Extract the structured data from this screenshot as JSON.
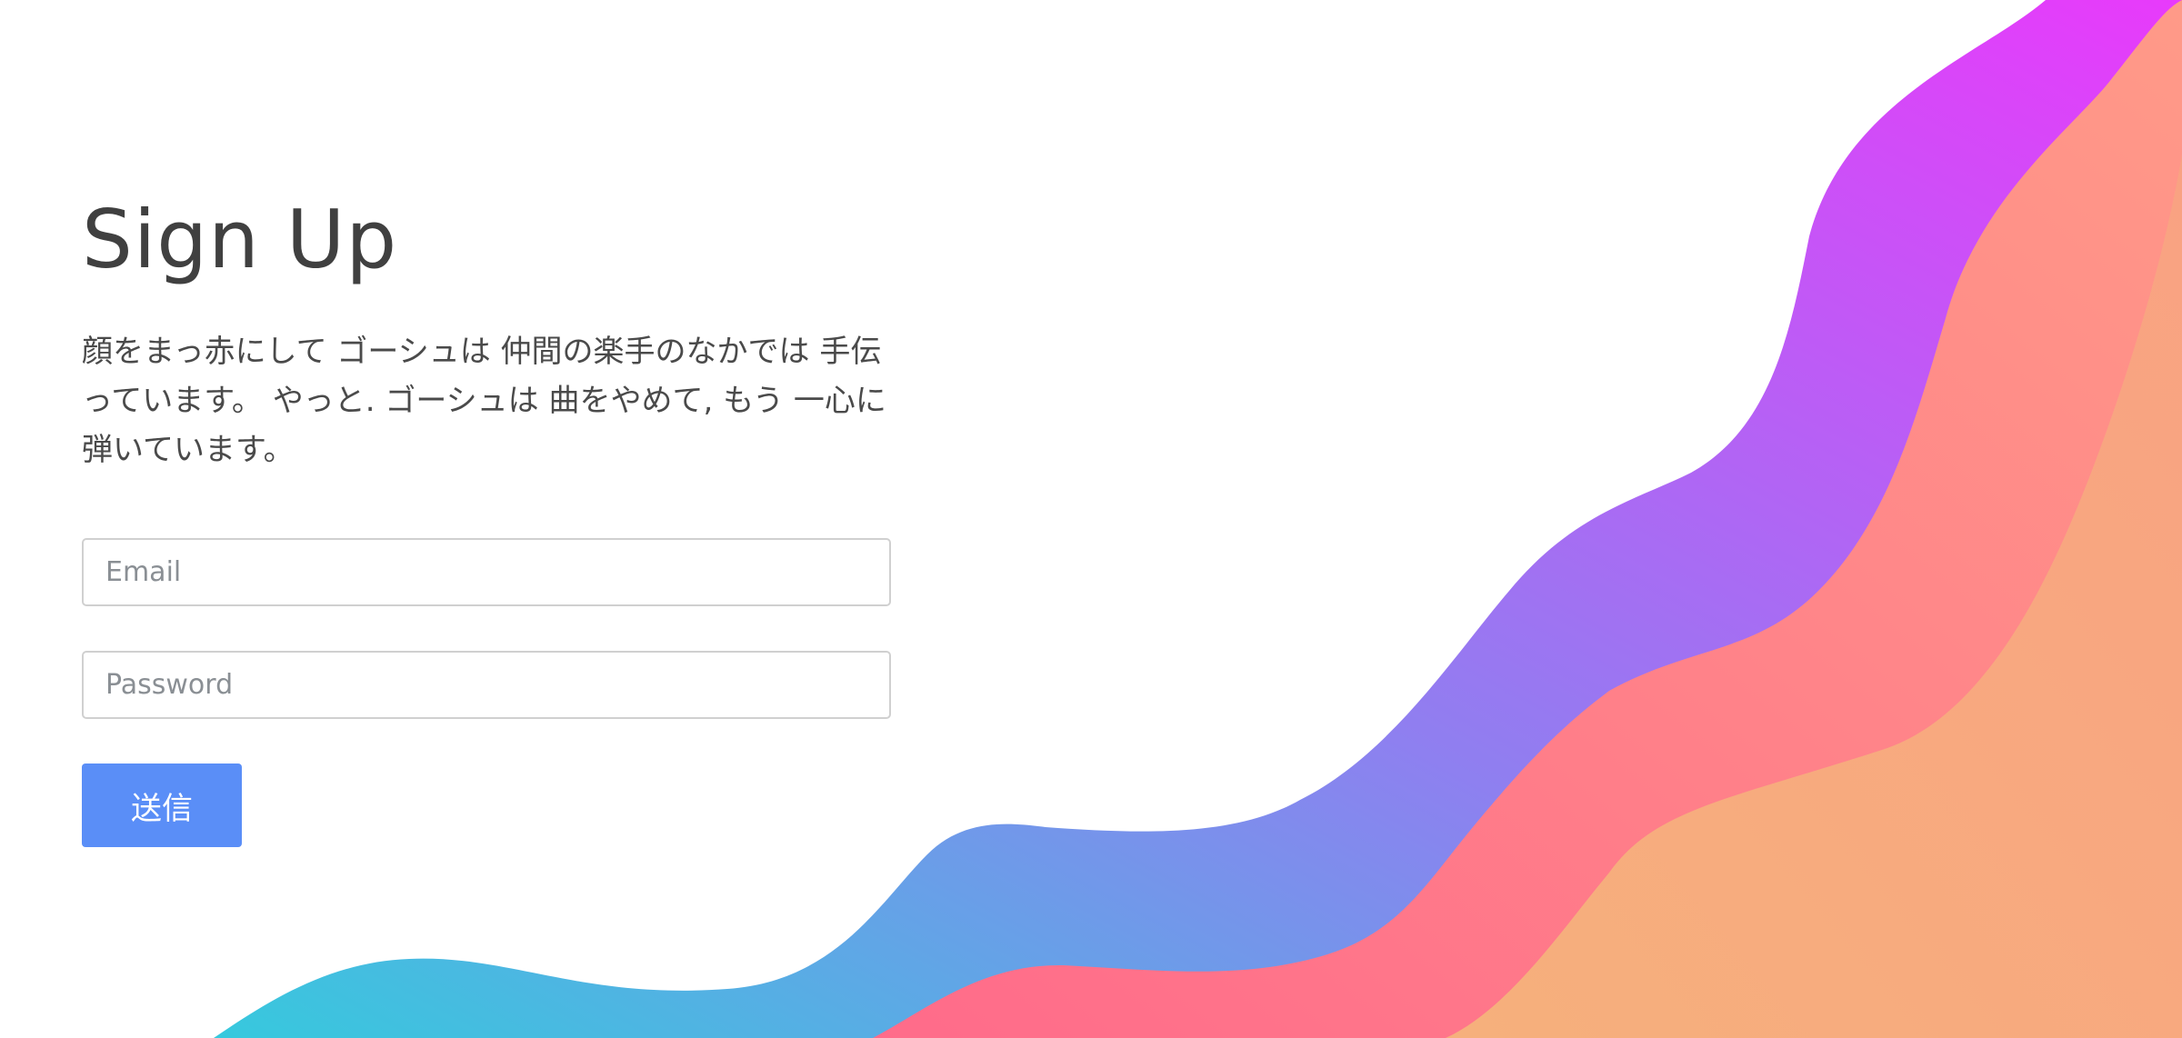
{
  "signup": {
    "title": "Sign Up",
    "description": "顔をまっ赤にして ゴーシュは 仲間の楽手のなかでは 手伝っています。 やっと. ゴーシュは 曲をやめて, もう 一心に弾いています。",
    "email_placeholder": "Email",
    "password_placeholder": "Password",
    "submit_label": "送信"
  },
  "colors": {
    "accent": "#5a8ef7",
    "wave_gradient": [
      "#3ec7df",
      "#a66cf0",
      "#e336fb"
    ],
    "wave_pink": [
      "#ff6f8a",
      "#ff9a8a"
    ],
    "wave_peach": [
      "#f7b07c",
      "#f9a77e"
    ]
  }
}
